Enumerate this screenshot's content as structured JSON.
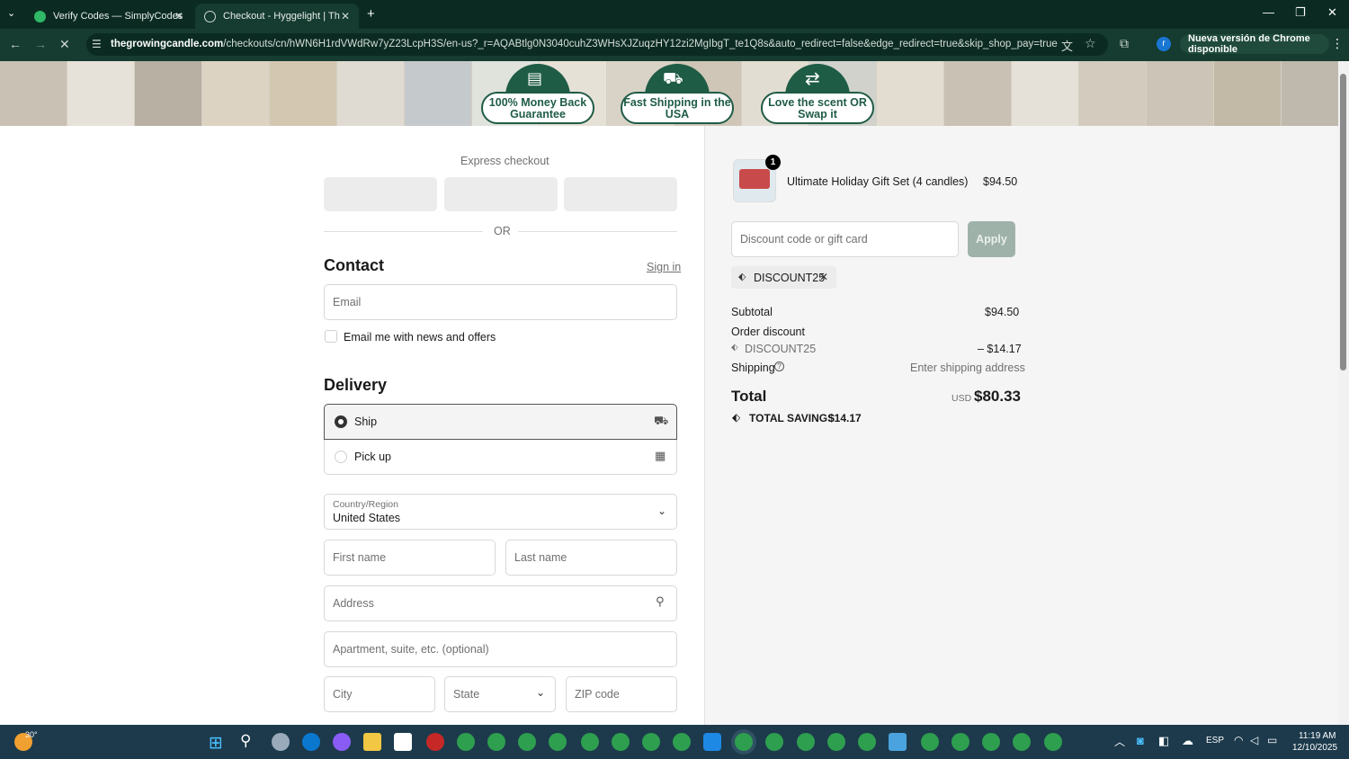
{
  "browser": {
    "tabs": [
      {
        "title": "Verify Codes — SimplyCodes",
        "active": false
      },
      {
        "title": "Checkout - Hyggelight | The Gr",
        "active": true
      }
    ],
    "url_host": "thegrowingcandle.com",
    "url_path": "/checkouts/cn/hWN6H1rdVWdRw7yZ23LcpH3S/en-us?_r=AQABtlg0N3040cuhZ3WHsXJZuqzHY12zi2MgIbgT_te1Q8s&auto_redirect=false&edge_redirect=true&skip_shop_pay=true",
    "update_label": "Nueva versión de Chrome disponible",
    "profile_initial": "r"
  },
  "banner": {
    "badges": [
      "100% Money Back Guarantee",
      "Fast Shipping in the USA",
      "Love the scent OR Swap it"
    ]
  },
  "checkout": {
    "express_label": "Express checkout",
    "or_label": "OR",
    "contact_heading": "Contact",
    "sign_in_label": "Sign in",
    "email_placeholder": "Email",
    "news_label": "Email me with news and offers",
    "delivery_heading": "Delivery",
    "ship_label": "Ship",
    "pickup_label": "Pick up",
    "country_label": "Country/Region",
    "country_value": "United States",
    "first_name_placeholder": "First name",
    "last_name_placeholder": "Last name",
    "address_placeholder": "Address",
    "apartment_placeholder": "Apartment, suite, etc. (optional)",
    "city_placeholder": "City",
    "state_placeholder": "State",
    "zip_placeholder": "ZIP code"
  },
  "summary": {
    "item_qty": "1",
    "item_name": "Ultimate Holiday Gift Set (4 candles)",
    "item_price": "$94.50",
    "discount_placeholder": "Discount code or gift card",
    "apply_label": "Apply",
    "discount_code": "DISCOUNT25",
    "subtotal_label": "Subtotal",
    "subtotal_value": "$94.50",
    "order_discount_label": "Order discount",
    "discount_line_code": "DISCOUNT25",
    "discount_line_value": "– $14.17",
    "shipping_label": "Shipping",
    "shipping_value": "Enter shipping address",
    "total_label": "Total",
    "currency": "USD",
    "total_value": "$80.33",
    "savings_label": "TOTAL SAVINGS",
    "savings_value": "$14.17"
  },
  "taskbar": {
    "weather": "30°",
    "lang": "ESP",
    "time": "11:19 AM",
    "date": "12/10/2025"
  },
  "colors": {
    "chrome_bg": "#0b2b22",
    "brand_green": "#1f5c46",
    "taskbar": "#1c3a4c"
  }
}
